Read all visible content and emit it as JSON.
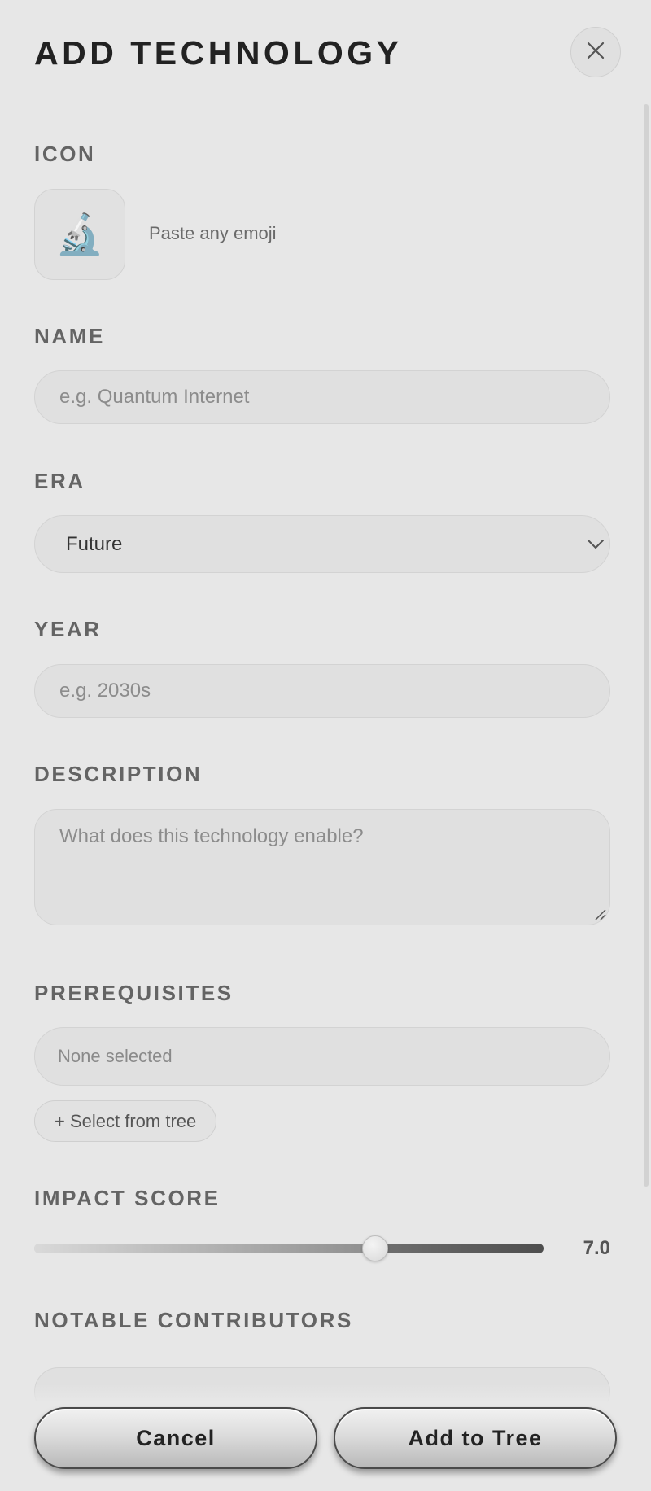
{
  "modal": {
    "title": "ADD TECHNOLOGY",
    "close_icon": "close-icon"
  },
  "icon_field": {
    "label": "ICON",
    "value": "🔬",
    "hint": "Paste any emoji"
  },
  "name_field": {
    "label": "NAME",
    "value": "",
    "placeholder": "e.g. Quantum Internet"
  },
  "era_field": {
    "label": "ERA",
    "selected": "Future",
    "icon": "chevron-down-icon"
  },
  "year_field": {
    "label": "YEAR",
    "value": "",
    "placeholder": "e.g. 2030s"
  },
  "description_field": {
    "label": "DESCRIPTION",
    "value": "",
    "placeholder": "What does this technology enable?"
  },
  "prerequisites_field": {
    "label": "PREREQUISITES",
    "selected_text": "None selected",
    "select_button": "+ Select from tree"
  },
  "impact_field": {
    "label": "IMPACT SCORE",
    "value_text": "7.0",
    "value": 7.0,
    "min": 0,
    "max": 10
  },
  "contributors_field": {
    "label": "NOTABLE CONTRIBUTORS"
  },
  "footer": {
    "cancel_label": "Cancel",
    "submit_label": "Add to Tree"
  },
  "colors": {
    "panel_bg": "#e7e7e7",
    "field_bg": "#e0e0e0",
    "label_text": "#646464",
    "title_text": "#222222"
  }
}
